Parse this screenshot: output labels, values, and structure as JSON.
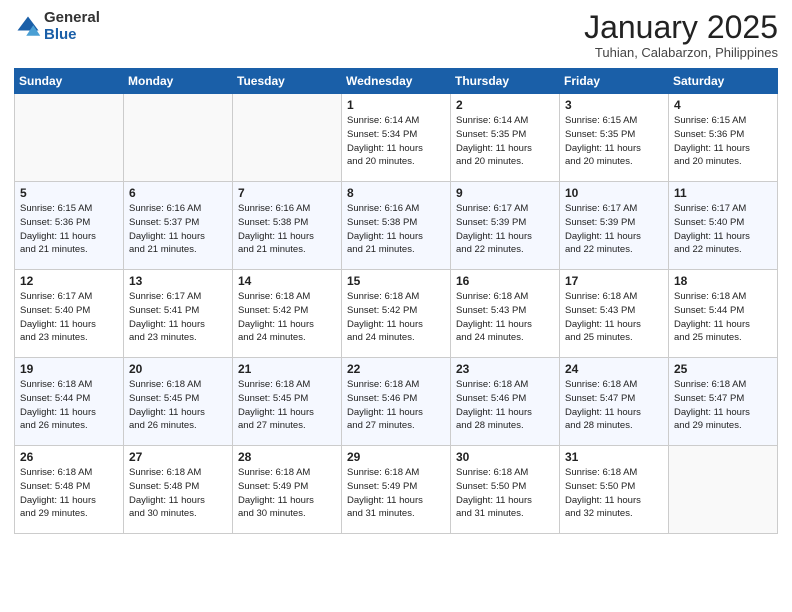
{
  "header": {
    "logo_general": "General",
    "logo_blue": "Blue",
    "month_title": "January 2025",
    "location": "Tuhian, Calabarzon, Philippines"
  },
  "weekdays": [
    "Sunday",
    "Monday",
    "Tuesday",
    "Wednesday",
    "Thursday",
    "Friday",
    "Saturday"
  ],
  "weeks": [
    [
      {
        "day": "",
        "info": ""
      },
      {
        "day": "",
        "info": ""
      },
      {
        "day": "",
        "info": ""
      },
      {
        "day": "1",
        "info": "Sunrise: 6:14 AM\nSunset: 5:34 PM\nDaylight: 11 hours\nand 20 minutes."
      },
      {
        "day": "2",
        "info": "Sunrise: 6:14 AM\nSunset: 5:35 PM\nDaylight: 11 hours\nand 20 minutes."
      },
      {
        "day": "3",
        "info": "Sunrise: 6:15 AM\nSunset: 5:35 PM\nDaylight: 11 hours\nand 20 minutes."
      },
      {
        "day": "4",
        "info": "Sunrise: 6:15 AM\nSunset: 5:36 PM\nDaylight: 11 hours\nand 20 minutes."
      }
    ],
    [
      {
        "day": "5",
        "info": "Sunrise: 6:15 AM\nSunset: 5:36 PM\nDaylight: 11 hours\nand 21 minutes."
      },
      {
        "day": "6",
        "info": "Sunrise: 6:16 AM\nSunset: 5:37 PM\nDaylight: 11 hours\nand 21 minutes."
      },
      {
        "day": "7",
        "info": "Sunrise: 6:16 AM\nSunset: 5:38 PM\nDaylight: 11 hours\nand 21 minutes."
      },
      {
        "day": "8",
        "info": "Sunrise: 6:16 AM\nSunset: 5:38 PM\nDaylight: 11 hours\nand 21 minutes."
      },
      {
        "day": "9",
        "info": "Sunrise: 6:17 AM\nSunset: 5:39 PM\nDaylight: 11 hours\nand 22 minutes."
      },
      {
        "day": "10",
        "info": "Sunrise: 6:17 AM\nSunset: 5:39 PM\nDaylight: 11 hours\nand 22 minutes."
      },
      {
        "day": "11",
        "info": "Sunrise: 6:17 AM\nSunset: 5:40 PM\nDaylight: 11 hours\nand 22 minutes."
      }
    ],
    [
      {
        "day": "12",
        "info": "Sunrise: 6:17 AM\nSunset: 5:40 PM\nDaylight: 11 hours\nand 23 minutes."
      },
      {
        "day": "13",
        "info": "Sunrise: 6:17 AM\nSunset: 5:41 PM\nDaylight: 11 hours\nand 23 minutes."
      },
      {
        "day": "14",
        "info": "Sunrise: 6:18 AM\nSunset: 5:42 PM\nDaylight: 11 hours\nand 24 minutes."
      },
      {
        "day": "15",
        "info": "Sunrise: 6:18 AM\nSunset: 5:42 PM\nDaylight: 11 hours\nand 24 minutes."
      },
      {
        "day": "16",
        "info": "Sunrise: 6:18 AM\nSunset: 5:43 PM\nDaylight: 11 hours\nand 24 minutes."
      },
      {
        "day": "17",
        "info": "Sunrise: 6:18 AM\nSunset: 5:43 PM\nDaylight: 11 hours\nand 25 minutes."
      },
      {
        "day": "18",
        "info": "Sunrise: 6:18 AM\nSunset: 5:44 PM\nDaylight: 11 hours\nand 25 minutes."
      }
    ],
    [
      {
        "day": "19",
        "info": "Sunrise: 6:18 AM\nSunset: 5:44 PM\nDaylight: 11 hours\nand 26 minutes."
      },
      {
        "day": "20",
        "info": "Sunrise: 6:18 AM\nSunset: 5:45 PM\nDaylight: 11 hours\nand 26 minutes."
      },
      {
        "day": "21",
        "info": "Sunrise: 6:18 AM\nSunset: 5:45 PM\nDaylight: 11 hours\nand 27 minutes."
      },
      {
        "day": "22",
        "info": "Sunrise: 6:18 AM\nSunset: 5:46 PM\nDaylight: 11 hours\nand 27 minutes."
      },
      {
        "day": "23",
        "info": "Sunrise: 6:18 AM\nSunset: 5:46 PM\nDaylight: 11 hours\nand 28 minutes."
      },
      {
        "day": "24",
        "info": "Sunrise: 6:18 AM\nSunset: 5:47 PM\nDaylight: 11 hours\nand 28 minutes."
      },
      {
        "day": "25",
        "info": "Sunrise: 6:18 AM\nSunset: 5:47 PM\nDaylight: 11 hours\nand 29 minutes."
      }
    ],
    [
      {
        "day": "26",
        "info": "Sunrise: 6:18 AM\nSunset: 5:48 PM\nDaylight: 11 hours\nand 29 minutes."
      },
      {
        "day": "27",
        "info": "Sunrise: 6:18 AM\nSunset: 5:48 PM\nDaylight: 11 hours\nand 30 minutes."
      },
      {
        "day": "28",
        "info": "Sunrise: 6:18 AM\nSunset: 5:49 PM\nDaylight: 11 hours\nand 30 minutes."
      },
      {
        "day": "29",
        "info": "Sunrise: 6:18 AM\nSunset: 5:49 PM\nDaylight: 11 hours\nand 31 minutes."
      },
      {
        "day": "30",
        "info": "Sunrise: 6:18 AM\nSunset: 5:50 PM\nDaylight: 11 hours\nand 31 minutes."
      },
      {
        "day": "31",
        "info": "Sunrise: 6:18 AM\nSunset: 5:50 PM\nDaylight: 11 hours\nand 32 minutes."
      },
      {
        "day": "",
        "info": ""
      }
    ]
  ]
}
